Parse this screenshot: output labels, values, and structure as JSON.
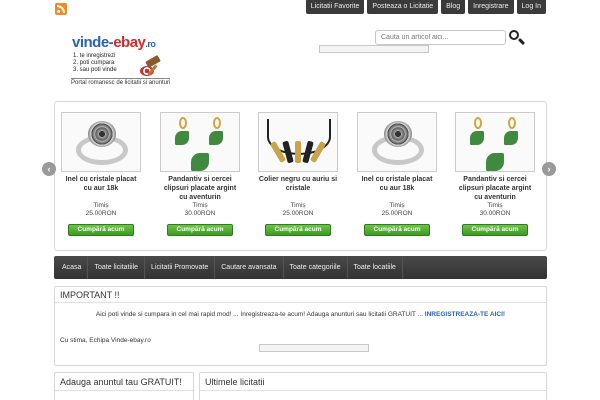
{
  "topnav": [
    "Licitatii Favorite",
    "Posteaza o Licitatie",
    "Blog",
    "Inregistrare",
    "Log In"
  ],
  "logo": {
    "brand_a": "vinde-",
    "brand_b": "ebay",
    "brand_c": ".ro",
    "steps": [
      "1. te inregistrezi",
      "2. poti cumpara",
      "3. sau poti vinde"
    ],
    "tagline": "Portal romanesc de licitatii si anunturi"
  },
  "search": {
    "placeholder": "Cauta un articol aici..."
  },
  "carousel": {
    "prev": "‹",
    "next": "›",
    "products": [
      {
        "title": "Inel cu cristale placat cu aur 18k",
        "location": "Timiș",
        "price": "25.00RON",
        "button": "Cumpără acum",
        "image": "ring"
      },
      {
        "title": "Pandantiv si cercei clipsuri placate argint cu aventurin",
        "location": "Timiș",
        "price": "30.00RON",
        "button": "Cumpără acum",
        "image": "earrings"
      },
      {
        "title": "Colier negru cu auriu si cristale",
        "location": "Timiș",
        "price": "25.00RON",
        "button": "Cumpără acum",
        "image": "necklace"
      },
      {
        "title": "Inel cu cristale placat cu aur 18k",
        "location": "Timiș",
        "price": "25.00RON",
        "button": "Cumpără acum",
        "image": "ring"
      },
      {
        "title": "Pandantiv si cercei clipsuri placate argint cu aventurin",
        "location": "Timiș",
        "price": "30.00RON",
        "button": "Cumpără acum",
        "image": "earrings"
      }
    ]
  },
  "mainnav": [
    "Acasa",
    "Toate licitatiile",
    "Licitatii Promovate",
    "Cautare avansata",
    "Toate categoriile",
    "Toate locatiile"
  ],
  "important": {
    "title": "IMPORTANT !!",
    "message": "Aici poti vinde si cumpara in cel mai rapid mod! ... Inregistreaza-te acum! Adauga anunturi sau licitatii GRATUIT ... ",
    "link": "INREGISTREAZA-TE AICI!",
    "signature": "Cu stima, Echipa Vinde-ebay.ro"
  },
  "boxes": {
    "left_title": "Adauga anuntul tau GRATUIT!",
    "right_title": "Ultimele licitatii"
  },
  "colors": {
    "accent": "#2a62b7",
    "buy_green": "#3c9a25",
    "nav_dark": "#3a3a3a",
    "rss": "#f28b24"
  }
}
